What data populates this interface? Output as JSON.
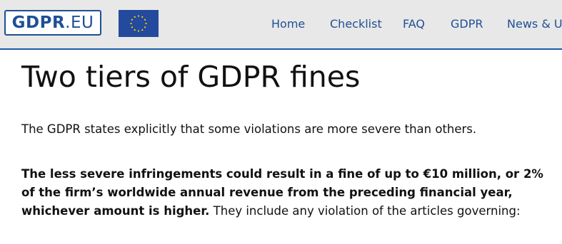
{
  "header": {
    "logo_bold": "GDPR",
    "logo_light": ".EU",
    "flag_icon": "eu-flag-icon",
    "nav": [
      "Home",
      "Checklist",
      "FAQ",
      "GDPR",
      "News & Up"
    ],
    "colors": {
      "brand": "#1f4f95",
      "header_bg": "#e8e8e8",
      "flag": "#234a9c",
      "stars": "#f5d500"
    }
  },
  "main": {
    "title": "Two tiers of GDPR fines",
    "intro": "The GDPR states explicitly that some violations are more severe than others.",
    "tier_bold": "The less severe infringements could result in a fine of up to €10 million, or 2% of the firm’s worldwide annual revenue from the preceding financial year, whichever amount is higher.",
    "tier_rest": " They include any violation of the articles governing:"
  }
}
